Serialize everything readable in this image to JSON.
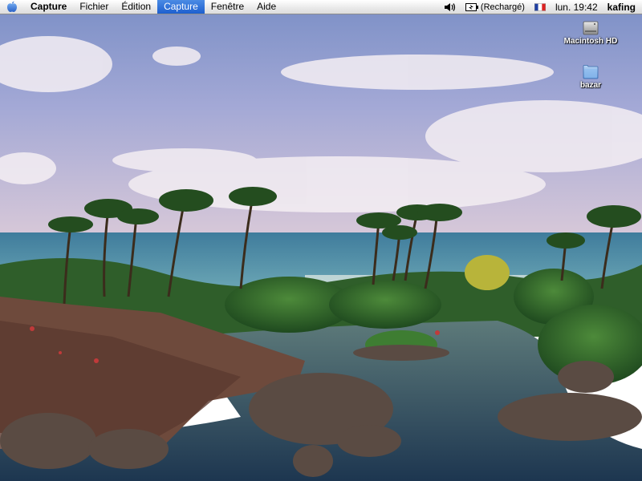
{
  "menubar": {
    "app_name": "Capture",
    "menus": [
      "Fichier",
      "Édition",
      "Capture",
      "Fenêtre",
      "Aide"
    ],
    "active_menu": "Capture",
    "battery_text": "(Rechargé)",
    "language_flag": "french-flag-icon",
    "clock": "lun. 19:42",
    "user": "kafing"
  },
  "desktop": {
    "icons": [
      {
        "label": "Macintosh HD",
        "icon": "hard-drive-icon"
      },
      {
        "label": "bazar",
        "icon": "folder-icon"
      }
    ]
  },
  "colors": {
    "menu_highlight": "#2f6fd8",
    "sky": "#8fa0cf",
    "ocean": "#4f86a3",
    "foliage": "#2f6a2d"
  }
}
